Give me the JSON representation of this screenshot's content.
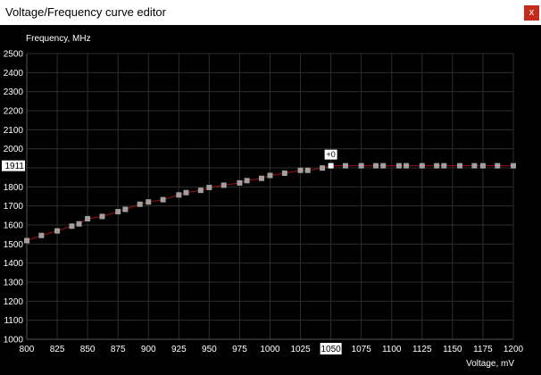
{
  "window": {
    "title": "Voltage/Frequency curve editor",
    "close_label": "x"
  },
  "chart_data": {
    "type": "line",
    "xlabel": "Voltage, mV",
    "ylabel": "Frequency, MHz",
    "xlim": [
      800,
      1200
    ],
    "ylim": [
      1000,
      2500
    ],
    "x_ticks": [
      800,
      825,
      850,
      875,
      900,
      925,
      950,
      975,
      1000,
      1025,
      1050,
      1075,
      1100,
      1125,
      1150,
      1175,
      1200
    ],
    "y_ticks": [
      1000,
      1100,
      1200,
      1300,
      1400,
      1500,
      1600,
      1700,
      1800,
      1900,
      2000,
      2100,
      2200,
      2300,
      2400,
      2500
    ],
    "grid": true,
    "selected": {
      "voltage": 1050,
      "frequency": 1911,
      "voltage_label": "1050",
      "frequency_label": "1911",
      "offset_label": "+0"
    },
    "series": [
      {
        "points": [
          [
            800,
            1518
          ],
          [
            812,
            1545
          ],
          [
            825,
            1569
          ],
          [
            837,
            1594
          ],
          [
            843,
            1606
          ],
          [
            850,
            1633
          ],
          [
            862,
            1645
          ],
          [
            875,
            1670
          ],
          [
            881,
            1682
          ],
          [
            893,
            1709
          ],
          [
            900,
            1721
          ],
          [
            912,
            1733
          ],
          [
            925,
            1758
          ],
          [
            931,
            1770
          ],
          [
            943,
            1782
          ],
          [
            950,
            1797
          ],
          [
            962,
            1809
          ],
          [
            975,
            1821
          ],
          [
            981,
            1833
          ],
          [
            993,
            1845
          ],
          [
            1000,
            1860
          ],
          [
            1012,
            1872
          ],
          [
            1025,
            1887
          ],
          [
            1031,
            1887
          ],
          [
            1043,
            1899
          ],
          [
            1050,
            1911
          ],
          [
            1062,
            1911
          ],
          [
            1075,
            1911
          ],
          [
            1087,
            1911
          ],
          [
            1093,
            1911
          ],
          [
            1106,
            1911
          ],
          [
            1112,
            1911
          ],
          [
            1125,
            1911
          ],
          [
            1137,
            1911
          ],
          [
            1143,
            1911
          ],
          [
            1156,
            1911
          ],
          [
            1168,
            1911
          ],
          [
            1175,
            1911
          ],
          [
            1187,
            1911
          ],
          [
            1200,
            1911
          ]
        ]
      }
    ],
    "colors": {
      "line": "#a01010",
      "point": "#a0a0a0",
      "selected_point": "#ffffff",
      "grid": "#2e2e2e"
    }
  }
}
